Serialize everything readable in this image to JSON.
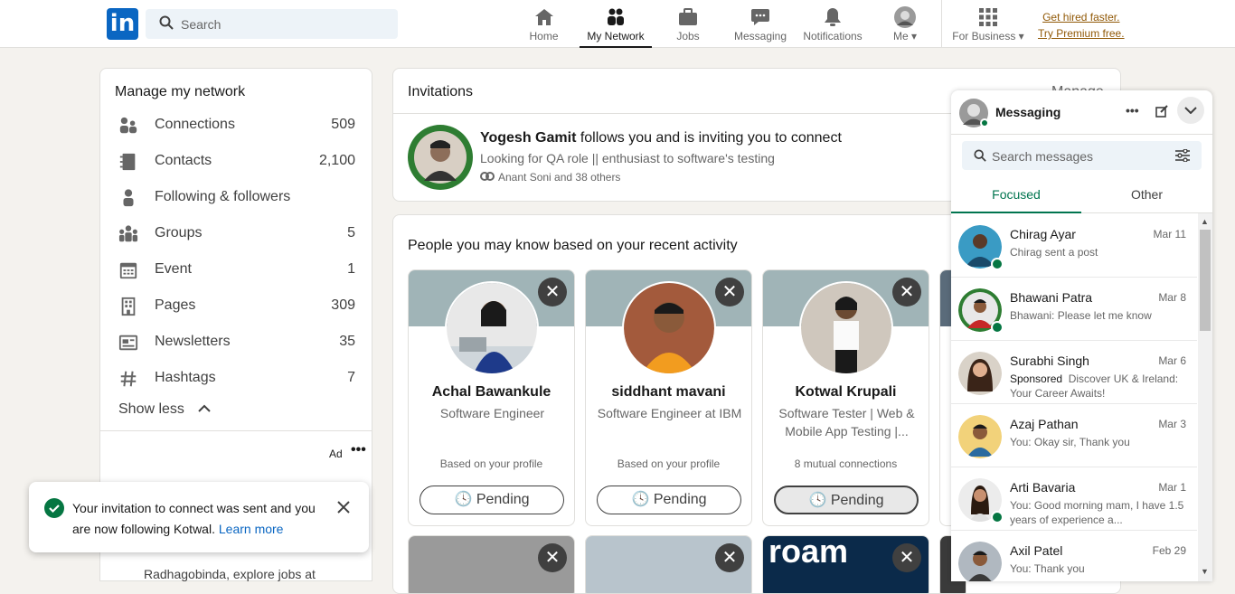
{
  "header": {
    "logo": "in",
    "search_placeholder": "Search",
    "nav": [
      {
        "label": "Home",
        "icon": "home-icon"
      },
      {
        "label": "My Network",
        "icon": "network-icon"
      },
      {
        "label": "Jobs",
        "icon": "briefcase-icon"
      },
      {
        "label": "Messaging",
        "icon": "messaging-icon"
      },
      {
        "label": "Notifications",
        "icon": "bell-icon"
      },
      {
        "label": "Me",
        "icon": "avatar"
      },
      {
        "label": "For Business",
        "icon": "grid-icon"
      }
    ],
    "premium_line1": "Get hired faster.",
    "premium_line2": "Try Premium free."
  },
  "sidebar": {
    "title": "Manage my network",
    "items": [
      {
        "label": "Connections",
        "count": "509",
        "icon": "connections-icon"
      },
      {
        "label": "Contacts",
        "count": "2,100",
        "icon": "contacts-icon"
      },
      {
        "label": "Following & followers",
        "count": "",
        "icon": "person-icon"
      },
      {
        "label": "Groups",
        "count": "5",
        "icon": "groups-icon"
      },
      {
        "label": "Event",
        "count": "1",
        "icon": "calendar-icon"
      },
      {
        "label": "Pages",
        "count": "309",
        "icon": "building-icon"
      },
      {
        "label": "Newsletters",
        "count": "35",
        "icon": "newsletter-icon"
      },
      {
        "label": "Hashtags",
        "count": "7",
        "icon": "hashtag-icon"
      }
    ],
    "show_less": "Show less",
    "ad_label": "Ad",
    "ad_text": "Radhagobinda, explore jobs at"
  },
  "toast": {
    "text": "Your invitation to connect was sent and you are now following Kotwal.",
    "link": "Learn more"
  },
  "invitations": {
    "title": "Invitations",
    "manage": "Manage",
    "name": "Yogesh Gamit",
    "action": " follows you and is inviting you to connect",
    "headline": "Looking for QA role || enthusiast to software's testing",
    "mutual": "Anant Soni and 38 others"
  },
  "pymk": {
    "title": "People you may know based on your recent activity",
    "cards": [
      {
        "name": "Achal Bawankule",
        "headline": "Software Engineer",
        "basis": "Based on your profile",
        "button": "Pending"
      },
      {
        "name": "siddhant mavani",
        "headline": "Software Engineer at IBM",
        "basis": "Based on your profile",
        "button": "Pending"
      },
      {
        "name": "Kotwal Krupali",
        "headline": "Software Tester | Web & Mobile App Testing |...",
        "basis": "8 mutual connections",
        "button": "Pending"
      }
    ],
    "row2_text": "roam"
  },
  "messaging": {
    "title": "Messaging",
    "search_placeholder": "Search messages",
    "tab_focused": "Focused",
    "tab_other": "Other",
    "conversations": [
      {
        "name": "Chirag Ayar",
        "date": "Mar 11",
        "preview": "Chirag sent a post",
        "sponsored": ""
      },
      {
        "name": "Bhawani Patra",
        "date": "Mar 8",
        "preview": "Bhawani: Please let me know",
        "sponsored": ""
      },
      {
        "name": "Surabhi Singh",
        "date": "Mar 6",
        "preview": "Discover UK & Ireland: Your Career Awaits!",
        "sponsored": "Sponsored"
      },
      {
        "name": "Azaj Pathan",
        "date": "Mar 3",
        "preview": "You: Okay sir, Thank you",
        "sponsored": ""
      },
      {
        "name": "Arti Bavaria",
        "date": "Mar 1",
        "preview": "You: Good morning mam, I have 1.5 years of experience a...",
        "sponsored": ""
      },
      {
        "name": "Axil Patel",
        "date": "Feb 29",
        "preview": "You: Thank you",
        "sponsored": ""
      }
    ]
  }
}
